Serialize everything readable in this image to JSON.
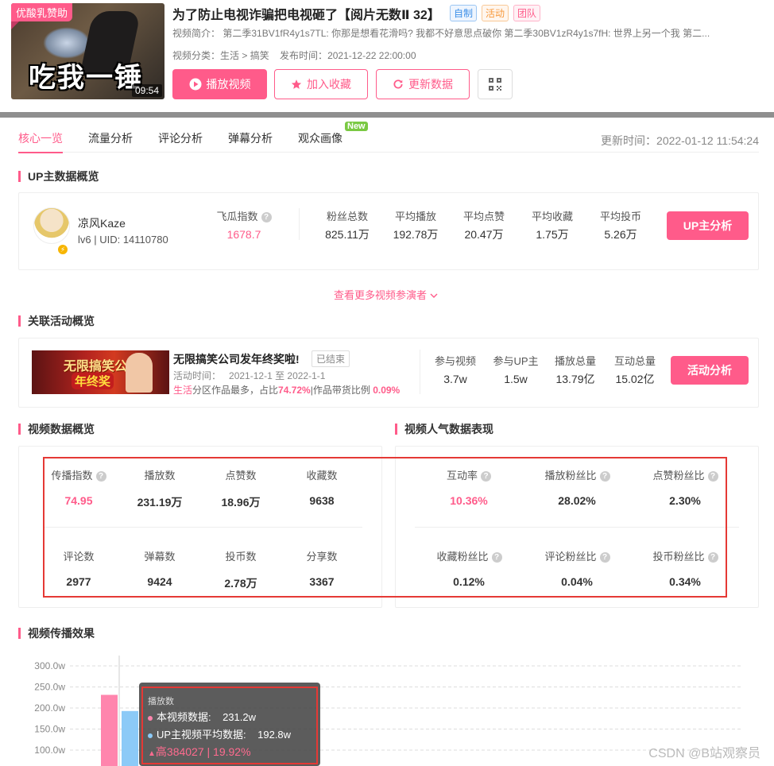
{
  "video": {
    "thumbnail_sponsor": "优酸乳赞助",
    "thumbnail_text": "吃我一锤",
    "duration": "09:54",
    "title": "为了防止电视诈骗把电视砸了【阅片无数Ⅱ 32】",
    "tags": [
      "自制",
      "活动",
      "团队"
    ],
    "desc_label": "视频简介：",
    "desc": "第二季31BV1fR4y1s7TL: 你那是想看花滑吗? 我都不好意思点破你 第二季30BV1zR4y1s7fH: 世界上另一个我 第二...",
    "category_label": "视频分类：",
    "category": "生活 > 搞笑",
    "publish_label": "发布时间：",
    "publish_time": "2021-12-22 22:00:00",
    "btn_play": "播放视频",
    "btn_fav": "加入收藏",
    "btn_refresh": "更新数据"
  },
  "tabs": [
    "核心一览",
    "流量分析",
    "评论分析",
    "弹幕分析",
    "观众画像"
  ],
  "tab_new_badge": "New",
  "update_time": "更新时间：2022-01-12 11:54:24",
  "up_section": {
    "title": "UP主数据概览",
    "name": "凉风Kaze",
    "level_uid": "lv6 | UID: 14110780",
    "feigua_label": "飞瓜指数",
    "feigua_value": "1678.7",
    "stats": [
      {
        "label": "粉丝总数",
        "value": "825.11万"
      },
      {
        "label": "平均播放",
        "value": "192.78万"
      },
      {
        "label": "平均点赞",
        "value": "20.47万"
      },
      {
        "label": "平均收藏",
        "value": "1.75万"
      },
      {
        "label": "平均投币",
        "value": "5.26万"
      }
    ],
    "btn": "UP主分析",
    "more": "查看更多视频参演者"
  },
  "activity_section": {
    "title": "关联活动概览",
    "image_text_1": "无限搞笑公司",
    "image_text_2": "年终奖",
    "act_title": "无限搞笑公司发年终奖啦!",
    "status": "已结束",
    "time_label": "活动时间：",
    "time": "2021-12-1 至 2022-1-1",
    "info_cat": "生活",
    "info_mid": "分区作品最多，占比",
    "info_pct": "74.72%",
    "info_mid2": "|作品带货比例",
    "info_pct2": "0.09%",
    "stats": [
      {
        "label": "参与视频",
        "value": "3.7w"
      },
      {
        "label": "参与UP主",
        "value": "1.5w"
      },
      {
        "label": "播放总量",
        "value": "13.79亿"
      },
      {
        "label": "互动总量",
        "value": "15.02亿"
      }
    ],
    "btn": "活动分析"
  },
  "video_data": {
    "title": "视频数据概览",
    "row1": [
      {
        "label": "传播指数",
        "value": "74.95",
        "help": true
      },
      {
        "label": "播放数",
        "value": "231.19万"
      },
      {
        "label": "点赞数",
        "value": "18.96万"
      },
      {
        "label": "收藏数",
        "value": "9638"
      }
    ],
    "row2": [
      {
        "label": "评论数",
        "value": "2977"
      },
      {
        "label": "弹幕数",
        "value": "9424"
      },
      {
        "label": "投币数",
        "value": "2.78万"
      },
      {
        "label": "分享数",
        "value": "3367"
      }
    ]
  },
  "popularity": {
    "title": "视频人气数据表现",
    "row1": [
      {
        "label": "互动率",
        "value": "10.36%"
      },
      {
        "label": "播放粉丝比",
        "value": "28.02%"
      },
      {
        "label": "点赞粉丝比",
        "value": "2.30%"
      }
    ],
    "row2": [
      {
        "label": "收藏粉丝比",
        "value": "0.12%"
      },
      {
        "label": "评论粉丝比",
        "value": "0.04%"
      },
      {
        "label": "投币粉丝比",
        "value": "0.34%"
      }
    ]
  },
  "spread_title": "视频传播效果",
  "chart_data": {
    "type": "bar",
    "y_ticks": [
      "300.0w",
      "250.0w",
      "200.0w",
      "150.0w",
      "100.0w"
    ],
    "ylim": [
      100,
      300
    ],
    "series": [
      {
        "name": "本视频数据",
        "color": "#ff85ad",
        "values": [
          231.2
        ]
      },
      {
        "name": "UP主视频平均数据",
        "color": "#8ccaf7",
        "values": [
          192.8
        ]
      }
    ]
  },
  "tooltip": {
    "title": "播放数",
    "row1_label": "本视频数据:",
    "row1_value": "231.2w",
    "row2_label": "UP主视频平均数据:",
    "row2_value": "192.8w",
    "diff": "高384027 | 19.92%"
  },
  "watermark": "CSDN @B站观察员",
  "colors": {
    "accent": "#ff5b8a",
    "highlight_box": "#e53935",
    "tag_blue": "#3c8fe8",
    "tag_orange": "#f79a3e"
  }
}
